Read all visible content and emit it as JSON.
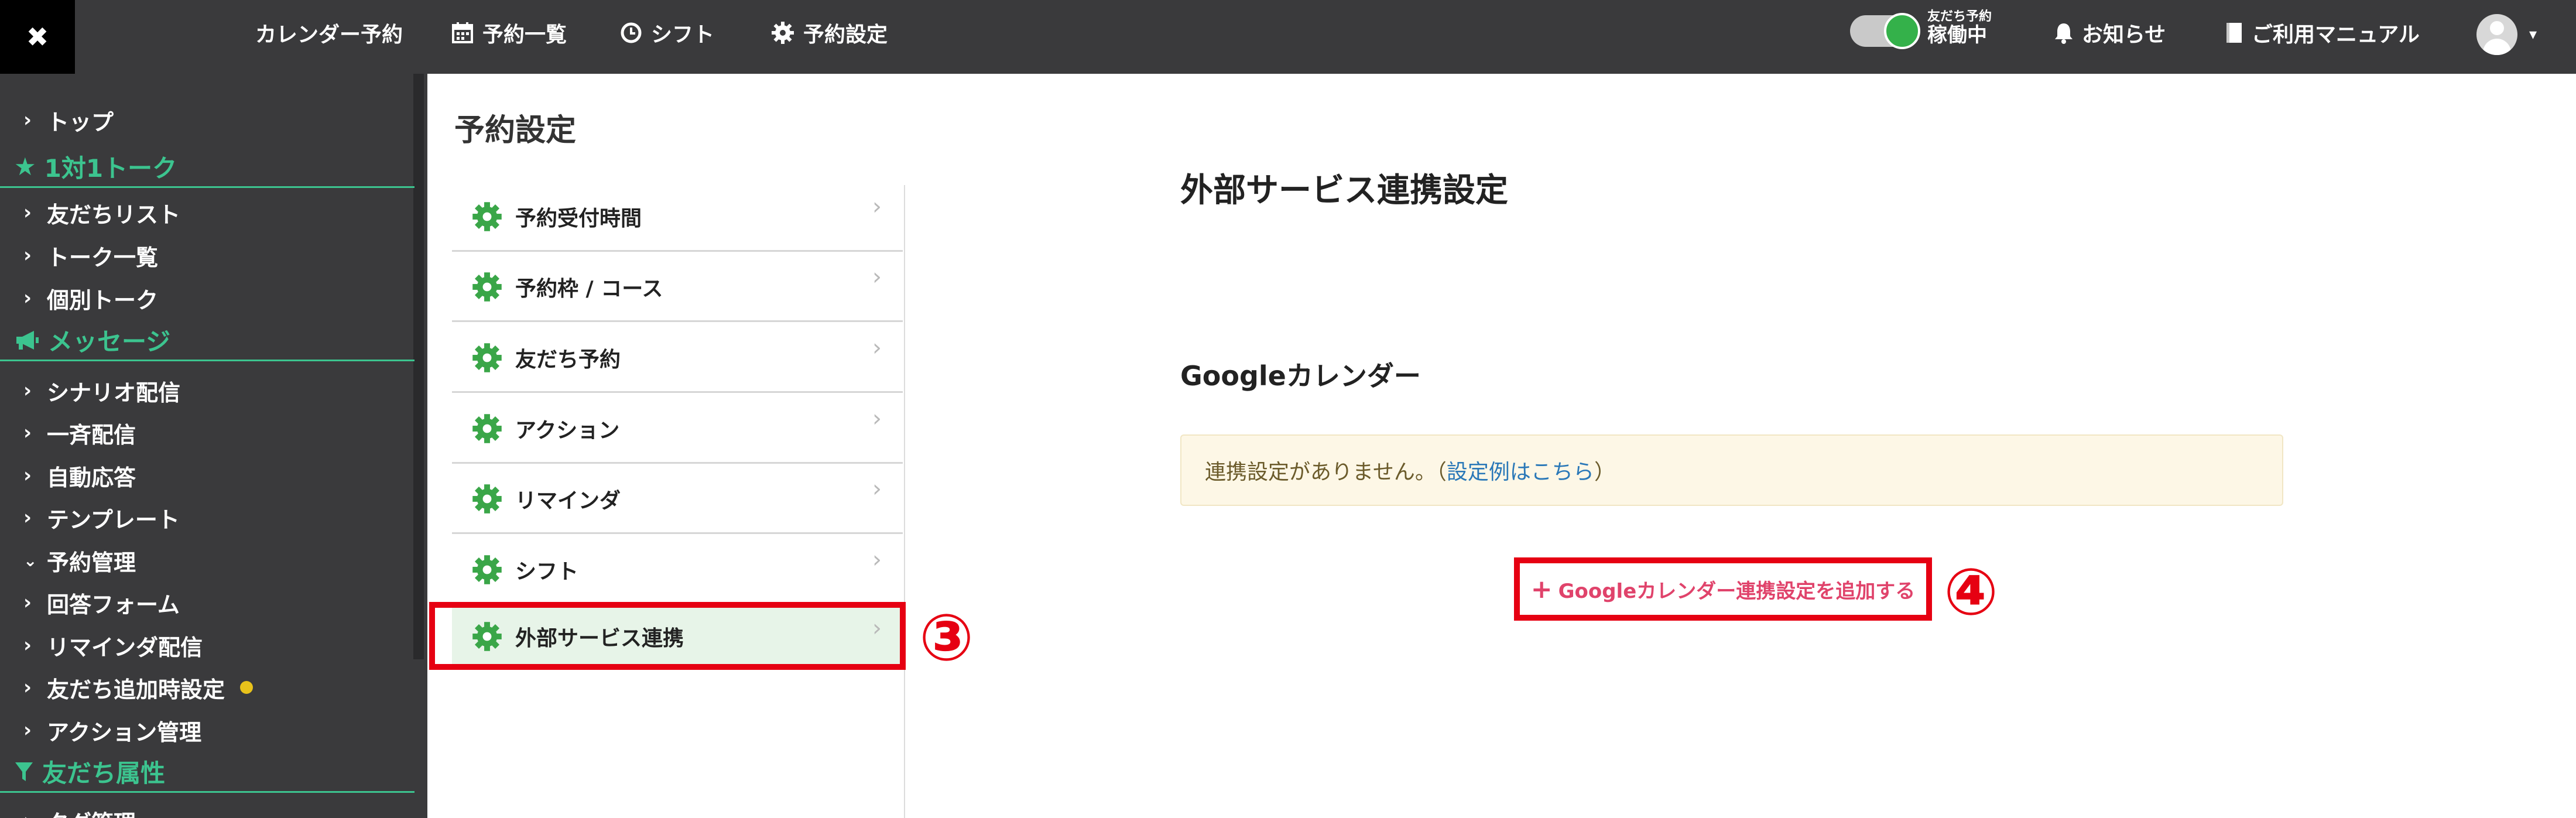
{
  "topbar": {
    "close_icon": "✖",
    "nav": [
      {
        "label": "カレンダー予約",
        "icon": ""
      },
      {
        "label": "予約一覧",
        "icon": "calendar-icon"
      },
      {
        "label": "シフト",
        "icon": "clock-icon"
      },
      {
        "label": "予約設定",
        "icon": "gear-icon"
      }
    ],
    "toggle": {
      "line1": "友だち予約",
      "line2": "稼働中",
      "on": true
    },
    "notice_label": "お知らせ",
    "manual_label": "ご利用マニュアル",
    "caret": "▾"
  },
  "sidebar": {
    "rows": [
      {
        "kind": "item",
        "label": "トップ"
      },
      {
        "kind": "section",
        "label": "1対1トーク",
        "icon": "star-icon"
      },
      {
        "kind": "item",
        "label": "友だちリスト"
      },
      {
        "kind": "item",
        "label": "トーク一覧"
      },
      {
        "kind": "item",
        "label": "個別トーク"
      },
      {
        "kind": "section",
        "label": "メッセージ",
        "icon": "megaphone-icon"
      },
      {
        "kind": "item",
        "label": "シナリオ配信"
      },
      {
        "kind": "item",
        "label": "一斉配信"
      },
      {
        "kind": "item",
        "label": "自動応答"
      },
      {
        "kind": "item",
        "label": "テンプレート"
      },
      {
        "kind": "item-open",
        "label": "予約管理"
      },
      {
        "kind": "item",
        "label": "回答フォーム"
      },
      {
        "kind": "item",
        "label": "リマインダ配信"
      },
      {
        "kind": "item-dot",
        "label": "友だち追加時設定"
      },
      {
        "kind": "item",
        "label": "アクション管理"
      },
      {
        "kind": "section",
        "label": "友だち属性",
        "icon": "filter-icon"
      },
      {
        "kind": "item",
        "label": "タグ管理"
      }
    ]
  },
  "settings": {
    "page_title": "予約設定",
    "menu": [
      {
        "label": "予約受付時間",
        "active": false
      },
      {
        "label": "予約枠 / コース",
        "active": false
      },
      {
        "label": "友だち予約",
        "active": false
      },
      {
        "label": "アクション",
        "active": false
      },
      {
        "label": "リマインダ",
        "active": false
      },
      {
        "label": "シフト",
        "active": false
      },
      {
        "label": "外部サービス連携",
        "active": true
      }
    ],
    "arrow": "›",
    "annotation_3": "③"
  },
  "content": {
    "title": "外部サービス連携設定",
    "google_title": "Googleカレンダー",
    "notice_text": "連携設定がありません。（",
    "notice_link": "設定例はこちら",
    "notice_close": "）",
    "add_button": "Googleカレンダー連携設定を追加する",
    "add_plus": "+",
    "annotation_4": "④"
  },
  "colors": {
    "topbar": "#3a3a3c",
    "accent_green": "#3cc48f",
    "highlight_red": "#e60012",
    "add_link_pink": "#e0436b",
    "notice_bg": "#fdf7e6"
  }
}
